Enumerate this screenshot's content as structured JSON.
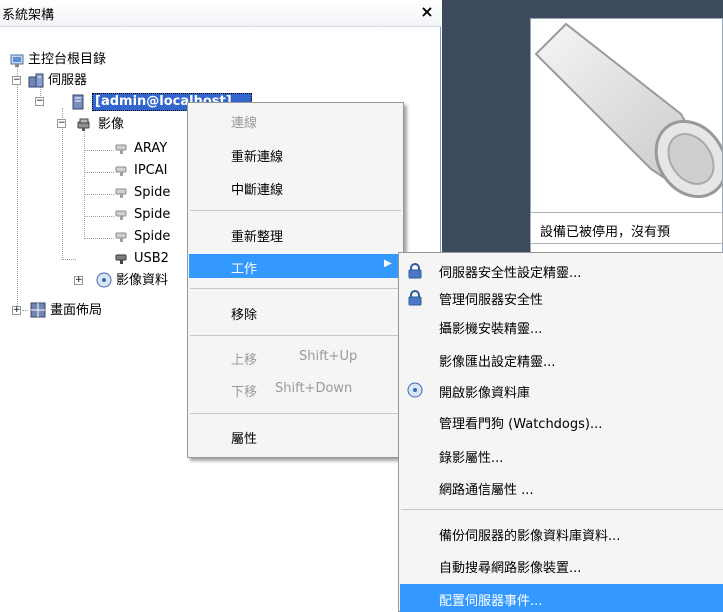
{
  "pane": {
    "title": "系統架構",
    "close_glyph": "×"
  },
  "tree": {
    "root": "主控台根目錄",
    "servers": "伺服器",
    "server_node": "[admin@localhost]",
    "video": "影像",
    "cameras": [
      "ARAY",
      "IPCAI",
      "Spide",
      "Spide",
      "Spide",
      "USB2"
    ],
    "video_db": "影像資料",
    "layout": "畫面佈局",
    "expander_minus": "−",
    "expander_plus": "+"
  },
  "status": {
    "message": "設備已被停用，沒有預"
  },
  "context_menu": {
    "items": [
      {
        "label": "連線",
        "enabled": false
      },
      {
        "label": "重新連線",
        "enabled": true
      },
      {
        "label": "中斷連線",
        "enabled": true
      },
      {
        "label": "重新整理",
        "enabled": true
      },
      {
        "label": "工作",
        "enabled": true,
        "highlighted": true,
        "submenu_glyph": "▶"
      },
      {
        "label": "移除",
        "enabled": true
      },
      {
        "label": "上移",
        "shortcut": "Shift+Up",
        "enabled": false
      },
      {
        "label": "下移",
        "shortcut": "Shift+Down",
        "enabled": false
      },
      {
        "label": "屬性",
        "enabled": true
      }
    ]
  },
  "submenu": {
    "items": [
      {
        "label": "伺服器安全性設定精靈...",
        "icon": "security-lock-icon"
      },
      {
        "label": "管理伺服器安全性",
        "icon": "security-lock-icon"
      },
      {
        "label": "攝影機安裝精靈...",
        "icon": ""
      },
      {
        "label": "影像匯出設定精靈...",
        "icon": ""
      },
      {
        "label": "開啟影像資料庫",
        "icon": "database-disc-icon"
      },
      {
        "label": "管理看門狗 (Watchdogs)...",
        "icon": ""
      },
      {
        "label": "錄影屬性...",
        "icon": ""
      },
      {
        "label": "網路通信屬性 ...",
        "icon": ""
      },
      {
        "label": "備份伺服器的影像資料庫資料...",
        "icon": ""
      },
      {
        "label": "自動搜尋網路影像裝置...",
        "icon": ""
      },
      {
        "label": "配置伺服器事件...",
        "icon": "",
        "highlighted": true
      }
    ]
  },
  "colors": {
    "highlight": "#3399ff",
    "right_pane_bg": "#3d4a5e",
    "selected_node_bg": "#3366cc"
  }
}
